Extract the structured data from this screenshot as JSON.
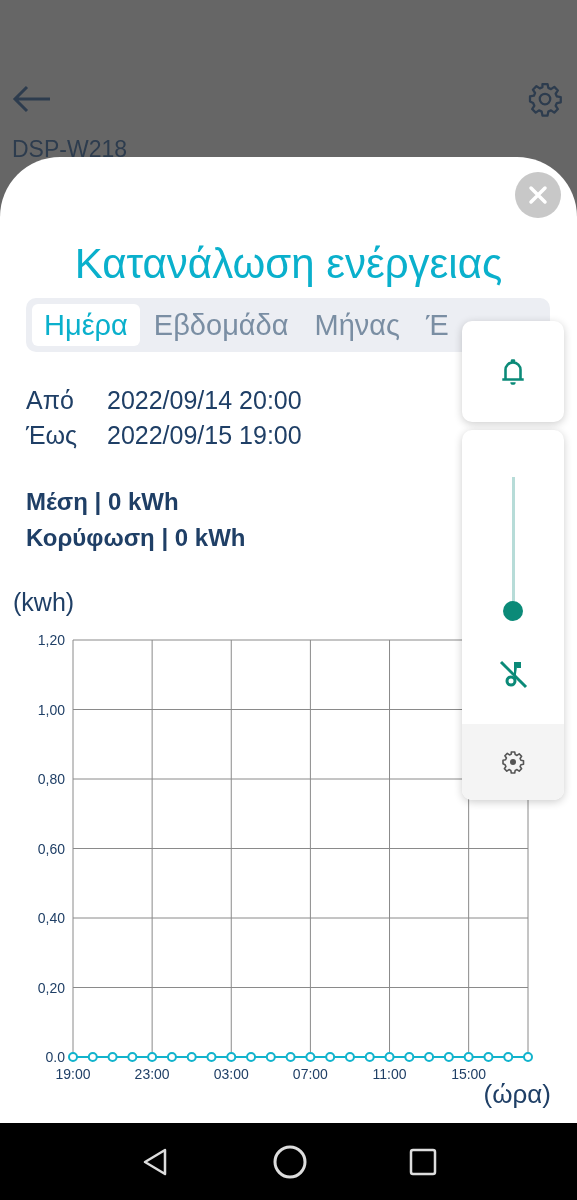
{
  "header": {
    "device_name": "DSP-W218"
  },
  "sheet": {
    "title": "Κατανάλωση ενέργειας",
    "tabs": [
      {
        "label": "Ημέρα",
        "selected": true
      },
      {
        "label": "Εβδομάδα",
        "selected": false
      },
      {
        "label": "Μήνας",
        "selected": false
      },
      {
        "label": "Έ",
        "selected": false
      }
    ],
    "range": [
      {
        "label": "Από",
        "value": "2022/09/14 20:00"
      },
      {
        "label": "Έως",
        "value": "2022/09/15 19:00"
      }
    ],
    "summary": [
      "Μέση | 0 kWh",
      "Κορύφωση | 0 kWh"
    ],
    "chart": {
      "chart_data": {
        "type": "line",
        "ylabel": "(kwh)",
        "xlabel": "(ώρα)",
        "grid": true,
        "categories": [
          "19:00",
          null,
          null,
          null,
          "23:00",
          null,
          null,
          null,
          "03:00",
          null,
          null,
          null,
          "07:00",
          null,
          null,
          null,
          "11:00",
          null,
          null,
          null,
          "15:00",
          null,
          null,
          null
        ],
        "series": [
          {
            "color": "#12b3cc",
            "marker": "circle",
            "values": [
              0,
              0,
              0,
              0,
              0,
              0,
              0,
              0,
              0,
              0,
              0,
              0,
              0,
              0,
              0,
              0,
              0,
              0,
              0,
              0,
              0,
              0,
              0,
              0
            ]
          }
        ],
        "ylim": [
          0,
          1.2
        ],
        "yticks": [
          {
            "value": 0,
            "label": "0.0"
          },
          {
            "value": 0.2,
            "label": "0,20"
          },
          {
            "value": 0.4,
            "label": "0,40"
          },
          {
            "value": 0.6,
            "label": "0,60"
          },
          {
            "value": 0.8,
            "label": "0,80"
          },
          {
            "value": 1.0,
            "label": "1,00"
          },
          {
            "value": 1.2,
            "label": "1,20"
          }
        ]
      }
    }
  },
  "volume_panel": {
    "level": 0
  }
}
